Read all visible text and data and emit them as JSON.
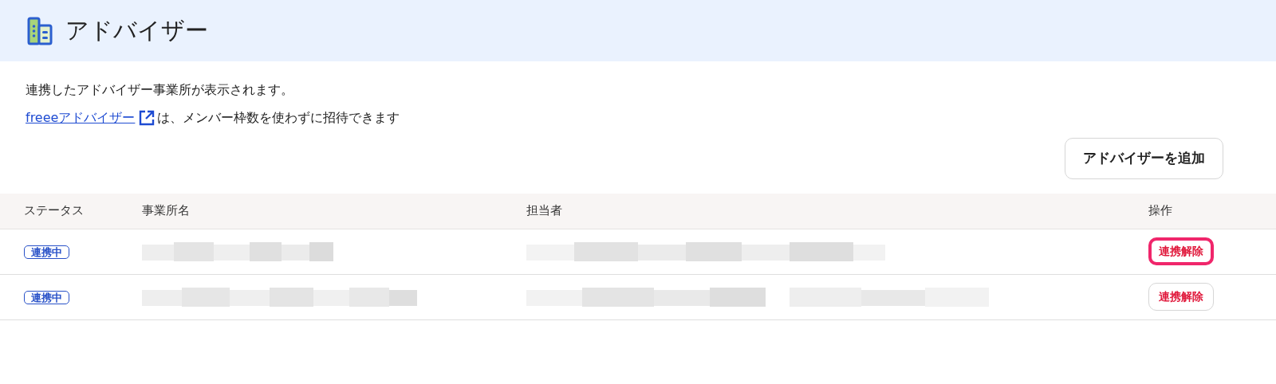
{
  "header": {
    "title": "アドバイザー"
  },
  "description": {
    "line_1": "連携したアドバイザー事業所が表示されます。",
    "link": "freeeアドバイザー",
    "line_2_rest": "は、メンバー枠数を使わずに招待できます"
  },
  "add_button": "アドバイザーを追加",
  "table": {
    "columns": [
      "ステータス",
      "事業所名",
      "担当者",
      "操作"
    ],
    "rows": [
      {
        "status": "連携中",
        "action": "連携解除",
        "highlighted": true
      },
      {
        "status": "連携中",
        "action": "連携解除",
        "highlighted": false
      }
    ]
  }
}
